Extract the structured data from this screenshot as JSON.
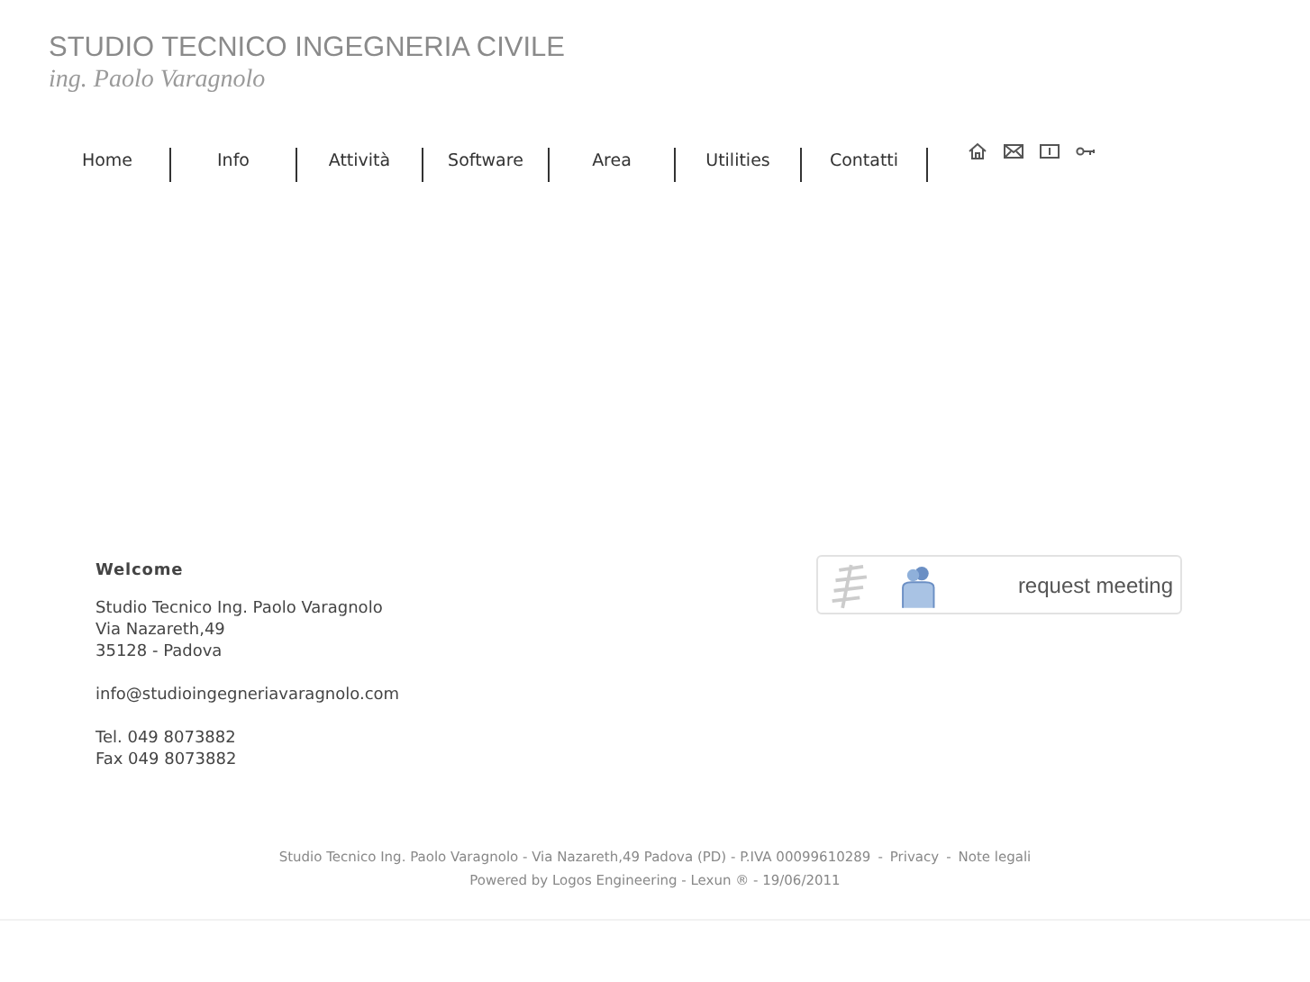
{
  "header": {
    "title": "STUDIO TECNICO INGEGNERIA CIVILE",
    "subtitle": "ing. Paolo Varagnolo"
  },
  "nav": [
    {
      "label": "Home"
    },
    {
      "label": "Info"
    },
    {
      "label": "Attività"
    },
    {
      "label": "Software"
    },
    {
      "label": "Area"
    },
    {
      "label": "Utilities"
    },
    {
      "label": "Contatti"
    }
  ],
  "contact": {
    "heading": "Welcome",
    "address": [
      "Studio Tecnico Ing. Paolo Varagnolo",
      "Via Nazareth,49",
      "35128 - Padova"
    ],
    "email": "info@studioingegneriavaragnolo.com",
    "phones": [
      "Tel. 049 8073882",
      "Fax 049 8073882"
    ]
  },
  "meeting_button": {
    "label": "request meeting"
  },
  "footer": {
    "info": "Studio Tecnico Ing. Paolo Varagnolo - Via Nazareth,49 Padova (PD) - P.IVA 00099610289",
    "separator": "-",
    "links": [
      "Privacy",
      "Note legali"
    ],
    "powered": "Powered by Logos Engineering - Lexun ® - 19/06/2011"
  }
}
